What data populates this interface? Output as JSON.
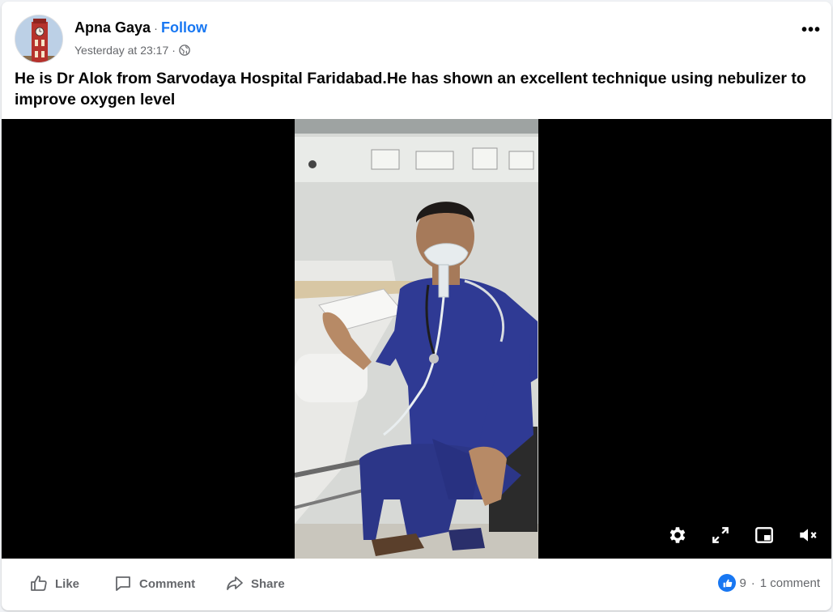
{
  "post": {
    "author": "Apna Gaya",
    "separator": "·",
    "follow_label": "Follow",
    "timestamp": "Yesterday at 23:17",
    "audience_icon": "globe-icon",
    "more_icon": "more-options-icon",
    "more_label": "•••",
    "text": "He is Dr Alok from Sarvodaya Hospital Faridabad.He has shown an excellent technique using nebulizer to improve oxygen level"
  },
  "video": {
    "controls": [
      "settings-icon",
      "fullscreen-icon",
      "picture-in-picture-icon",
      "mute-icon"
    ]
  },
  "actions": {
    "like_label": "Like",
    "comment_label": "Comment",
    "share_label": "Share"
  },
  "stats": {
    "reactions_count": "9",
    "separator": "·",
    "comments_label": "1 comment"
  },
  "colors": {
    "accent": "#1877f2",
    "secondary_text": "#65676b",
    "video_background": "#000000"
  }
}
